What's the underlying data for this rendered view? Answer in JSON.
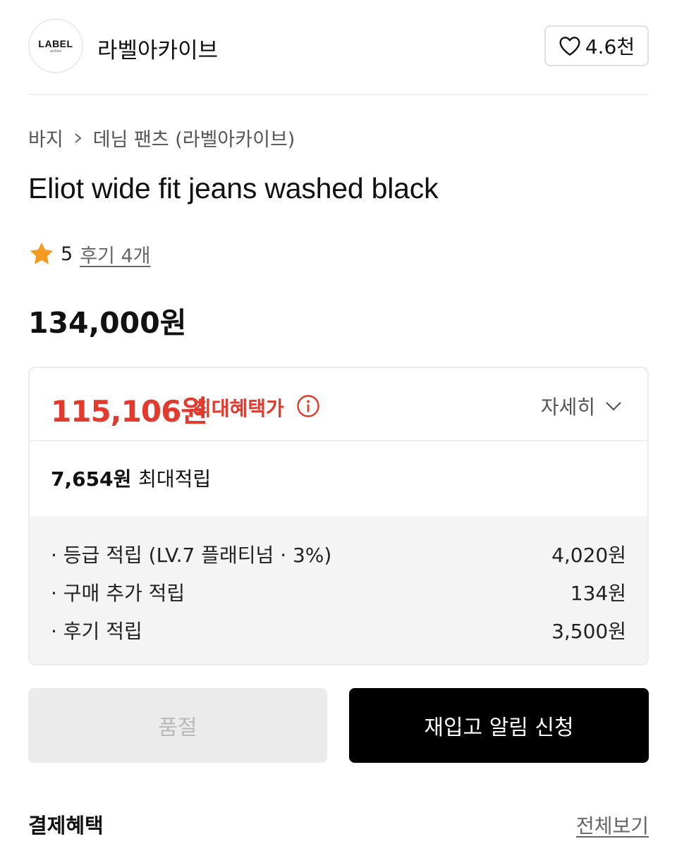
{
  "brand": {
    "logo_text": "LABEL",
    "logo_subtext": "archive",
    "name": "라벨아카이브",
    "like_count": "4.6천"
  },
  "breadcrumb": {
    "category": "바지",
    "subcategory": "데님 팬츠 (라벨아카이브)"
  },
  "product": {
    "title": "Eliot wide fit jeans washed black",
    "rating": "5",
    "review_link": "후기 4개",
    "price": "134,000원"
  },
  "benefit": {
    "max_price": "115,106원",
    "max_label": "최대혜택가",
    "detail_toggle": "자세히",
    "points_amount": "7,654원",
    "points_label": "최대적립",
    "items": [
      {
        "label": "· 등급 적립 (LV.7 플래티넘 · 3%)",
        "value": "4,020원"
      },
      {
        "label": "· 구매 추가 적립",
        "value": "134원"
      },
      {
        "label": "· 후기 적립",
        "value": "3,500원"
      }
    ],
    "accent_color": "#e23b2e"
  },
  "actions": {
    "soldout_label": "품절",
    "restock_label": "재입고 알림 신청"
  },
  "payment": {
    "title": "결제혜택",
    "view_all": "전체보기"
  },
  "icons": [
    "heart-icon",
    "chevron-right-icon",
    "star-icon",
    "info-icon",
    "chevron-down-icon"
  ]
}
